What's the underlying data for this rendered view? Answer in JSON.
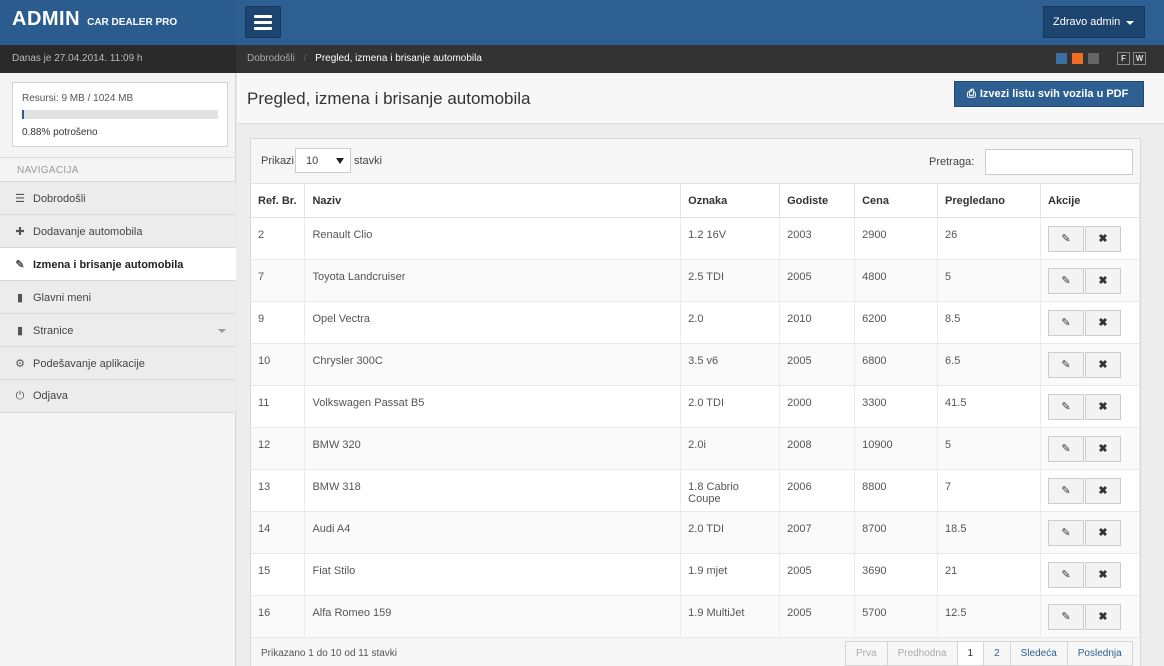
{
  "app": {
    "brand_main": "ADMIN",
    "brand_sub": "CAR DEALER PRO"
  },
  "header": {
    "user_label": "Zdravo admin"
  },
  "infobar": {
    "date": "Danas je 27.04.2014. 11:09 h"
  },
  "breadcrumb": {
    "home": "Dobrodošli",
    "separator": "/",
    "current": "Pregled, izmena i brisanje automobila"
  },
  "theme": {
    "swatches": [
      "#3a6ea5",
      "#f26d21",
      "#666666"
    ],
    "buttons": [
      "F",
      "W"
    ]
  },
  "resources": {
    "label": "Resursi: 9 MB / 1024 MB",
    "used_fraction": 0.0088,
    "percent_label": "0.88% potrošeno"
  },
  "sidebar": {
    "heading": "NAVIGACIJA",
    "items": [
      {
        "label": "Dobrodošli",
        "icon": "list-icon",
        "glyph": "☰",
        "active": false
      },
      {
        "label": "Dodavanje automobila",
        "icon": "plus-icon",
        "glyph": "✚",
        "active": false
      },
      {
        "label": "Izmena i brisanje automobila",
        "icon": "edit-icon",
        "glyph": "✎",
        "active": true
      },
      {
        "label": "Glavni meni",
        "icon": "book-icon",
        "glyph": "▮",
        "active": false
      },
      {
        "label": "Stranice",
        "icon": "book-icon",
        "glyph": "▮",
        "active": false,
        "has_dropdown": true
      },
      {
        "label": "Podešavanje aplikacije",
        "icon": "gear-icon",
        "glyph": "⚙",
        "active": false
      },
      {
        "label": "Odjava",
        "icon": "power-icon",
        "glyph": "⏻",
        "active": false
      }
    ]
  },
  "page": {
    "title": "Pregled, izmena i brisanje automobila",
    "pdf_button": "Izvezi listu svih vozila u PDF"
  },
  "table_controls": {
    "show_label": "Prikazi",
    "show_value": "10",
    "show_after": "stavki",
    "search_label": "Pretraga:",
    "search_value": "",
    "search_placeholder": ""
  },
  "table": {
    "columns": [
      "Ref. Br.",
      "Naziv",
      "Oznaka",
      "Godiste",
      "Cena",
      "Pregledano",
      "Akcije"
    ],
    "rows": [
      [
        "2",
        "Renault Clio",
        "1.2 16V",
        "2003",
        "2900",
        "26"
      ],
      [
        "7",
        "Toyota Landcruiser",
        "2.5 TDI",
        "2005",
        "4800",
        "5"
      ],
      [
        "9",
        "Opel Vectra",
        "2.0",
        "2010",
        "6200",
        "8.5"
      ],
      [
        "10",
        "Chrysler 300C",
        "3.5 v6",
        "2005",
        "6800",
        "6.5"
      ],
      [
        "11",
        "Volkswagen Passat B5",
        "2.0 TDI",
        "2000",
        "3300",
        "41.5"
      ],
      [
        "12",
        "BMW 320",
        "2.0i",
        "2008",
        "10900",
        "5"
      ],
      [
        "13",
        "BMW 318",
        "1.8 Cabrio Coupe",
        "2006",
        "8800",
        "7"
      ],
      [
        "14",
        "Audi A4",
        "2.0 TDI",
        "2007",
        "8700",
        "18.5"
      ],
      [
        "15",
        "Fiat Stilo",
        "1.9 mjet",
        "2005",
        "3690",
        "21"
      ],
      [
        "16",
        "Alfa Romeo 159",
        "1.9 MultiJet",
        "2005",
        "5700",
        "12.5"
      ]
    ],
    "edit_glyph": "✎",
    "delete_glyph": "✖"
  },
  "footer": {
    "info": "Prikazano 1 do 10 od 11 stavki",
    "pager": [
      {
        "label": "Prva",
        "state": "disabled"
      },
      {
        "label": "Predhodna",
        "state": "disabled"
      },
      {
        "label": "1",
        "state": "active"
      },
      {
        "label": "2",
        "state": "normal"
      },
      {
        "label": "Sledeća",
        "state": "normal"
      },
      {
        "label": "Poslednja",
        "state": "normal"
      }
    ]
  }
}
